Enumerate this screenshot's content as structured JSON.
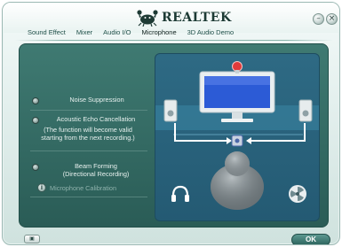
{
  "app": {
    "brand": "REALTEK"
  },
  "tabs": [
    {
      "label": "Sound Effect"
    },
    {
      "label": "Mixer"
    },
    {
      "label": "Audio I/O"
    },
    {
      "label": "Microphone",
      "active": true
    },
    {
      "label": "3D Audio Demo"
    }
  ],
  "options": {
    "noise_suppression": "Noise Suppression",
    "aec_title": "Acoustic Echo Cancellation",
    "aec_note_1": "(The function will become valid",
    "aec_note_2": "starting from the next recording.)",
    "beam_title": "Beam Forming",
    "beam_sub": "(Directional Recording)",
    "mic_calibration": "Microphone Calibration"
  },
  "footer": {
    "ok_label": "OK"
  },
  "colors": {
    "panel": "#2a5c56",
    "illustration_bg": "#245a73",
    "monitor_screen": "#2c5bd6",
    "record_dot": "#e23b3b"
  },
  "icons": {
    "minimize": "minimize-icon",
    "close": "close-icon",
    "calibration": "mic-calibration-icon",
    "footer_left": "info-icon",
    "speaker": "speaker-icon",
    "headset": "headset-icon",
    "fan": "fan-icon"
  }
}
